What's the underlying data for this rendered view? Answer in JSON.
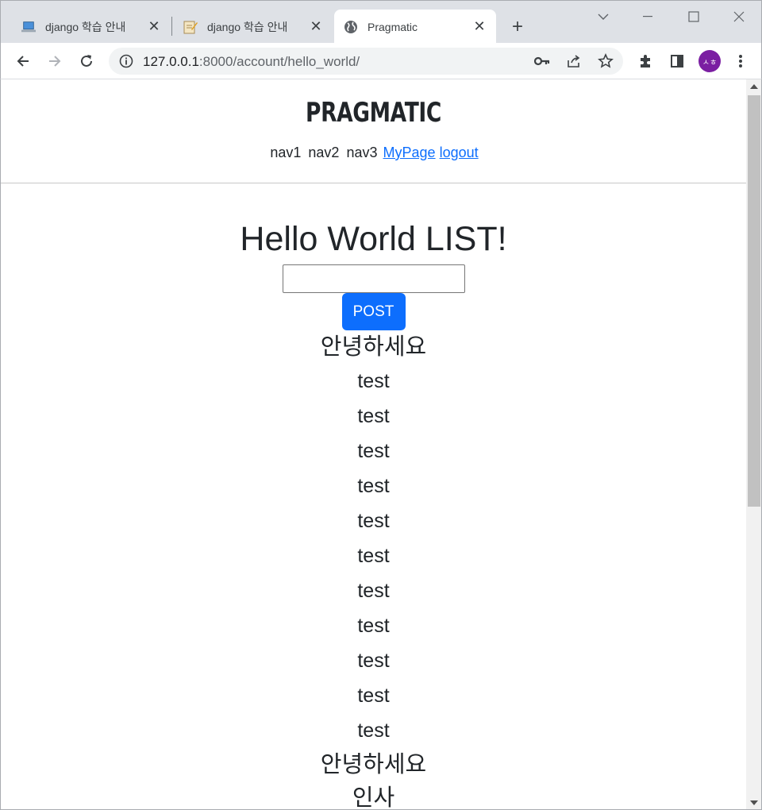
{
  "browser": {
    "tabs": [
      {
        "title": "django 학습 안내",
        "icon": "laptop-icon"
      },
      {
        "title": "django 학습 안내",
        "icon": "memo-icon"
      },
      {
        "title": "Pragmatic",
        "icon": "globe-icon"
      }
    ],
    "url_host": "127.0.0.1",
    "url_rest": ":8000/account/hello_world/",
    "avatar_text": "ㅅㅎ",
    "colors": {
      "avatar": "#7b1fa2",
      "accent": "#0d6efd"
    }
  },
  "site": {
    "logo": "PRAGMATIC",
    "nav": [
      "nav1",
      "nav2",
      "nav3"
    ],
    "nav_links": [
      "MyPage",
      "logout"
    ]
  },
  "main": {
    "title": "Hello World LIST!",
    "input_value": "",
    "post_label": "POST",
    "items": [
      "안녕하세요",
      "test",
      "test",
      "test",
      "test",
      "test",
      "test",
      "test",
      "test",
      "test",
      "test",
      "test",
      "안녕하세요",
      "인사"
    ]
  }
}
